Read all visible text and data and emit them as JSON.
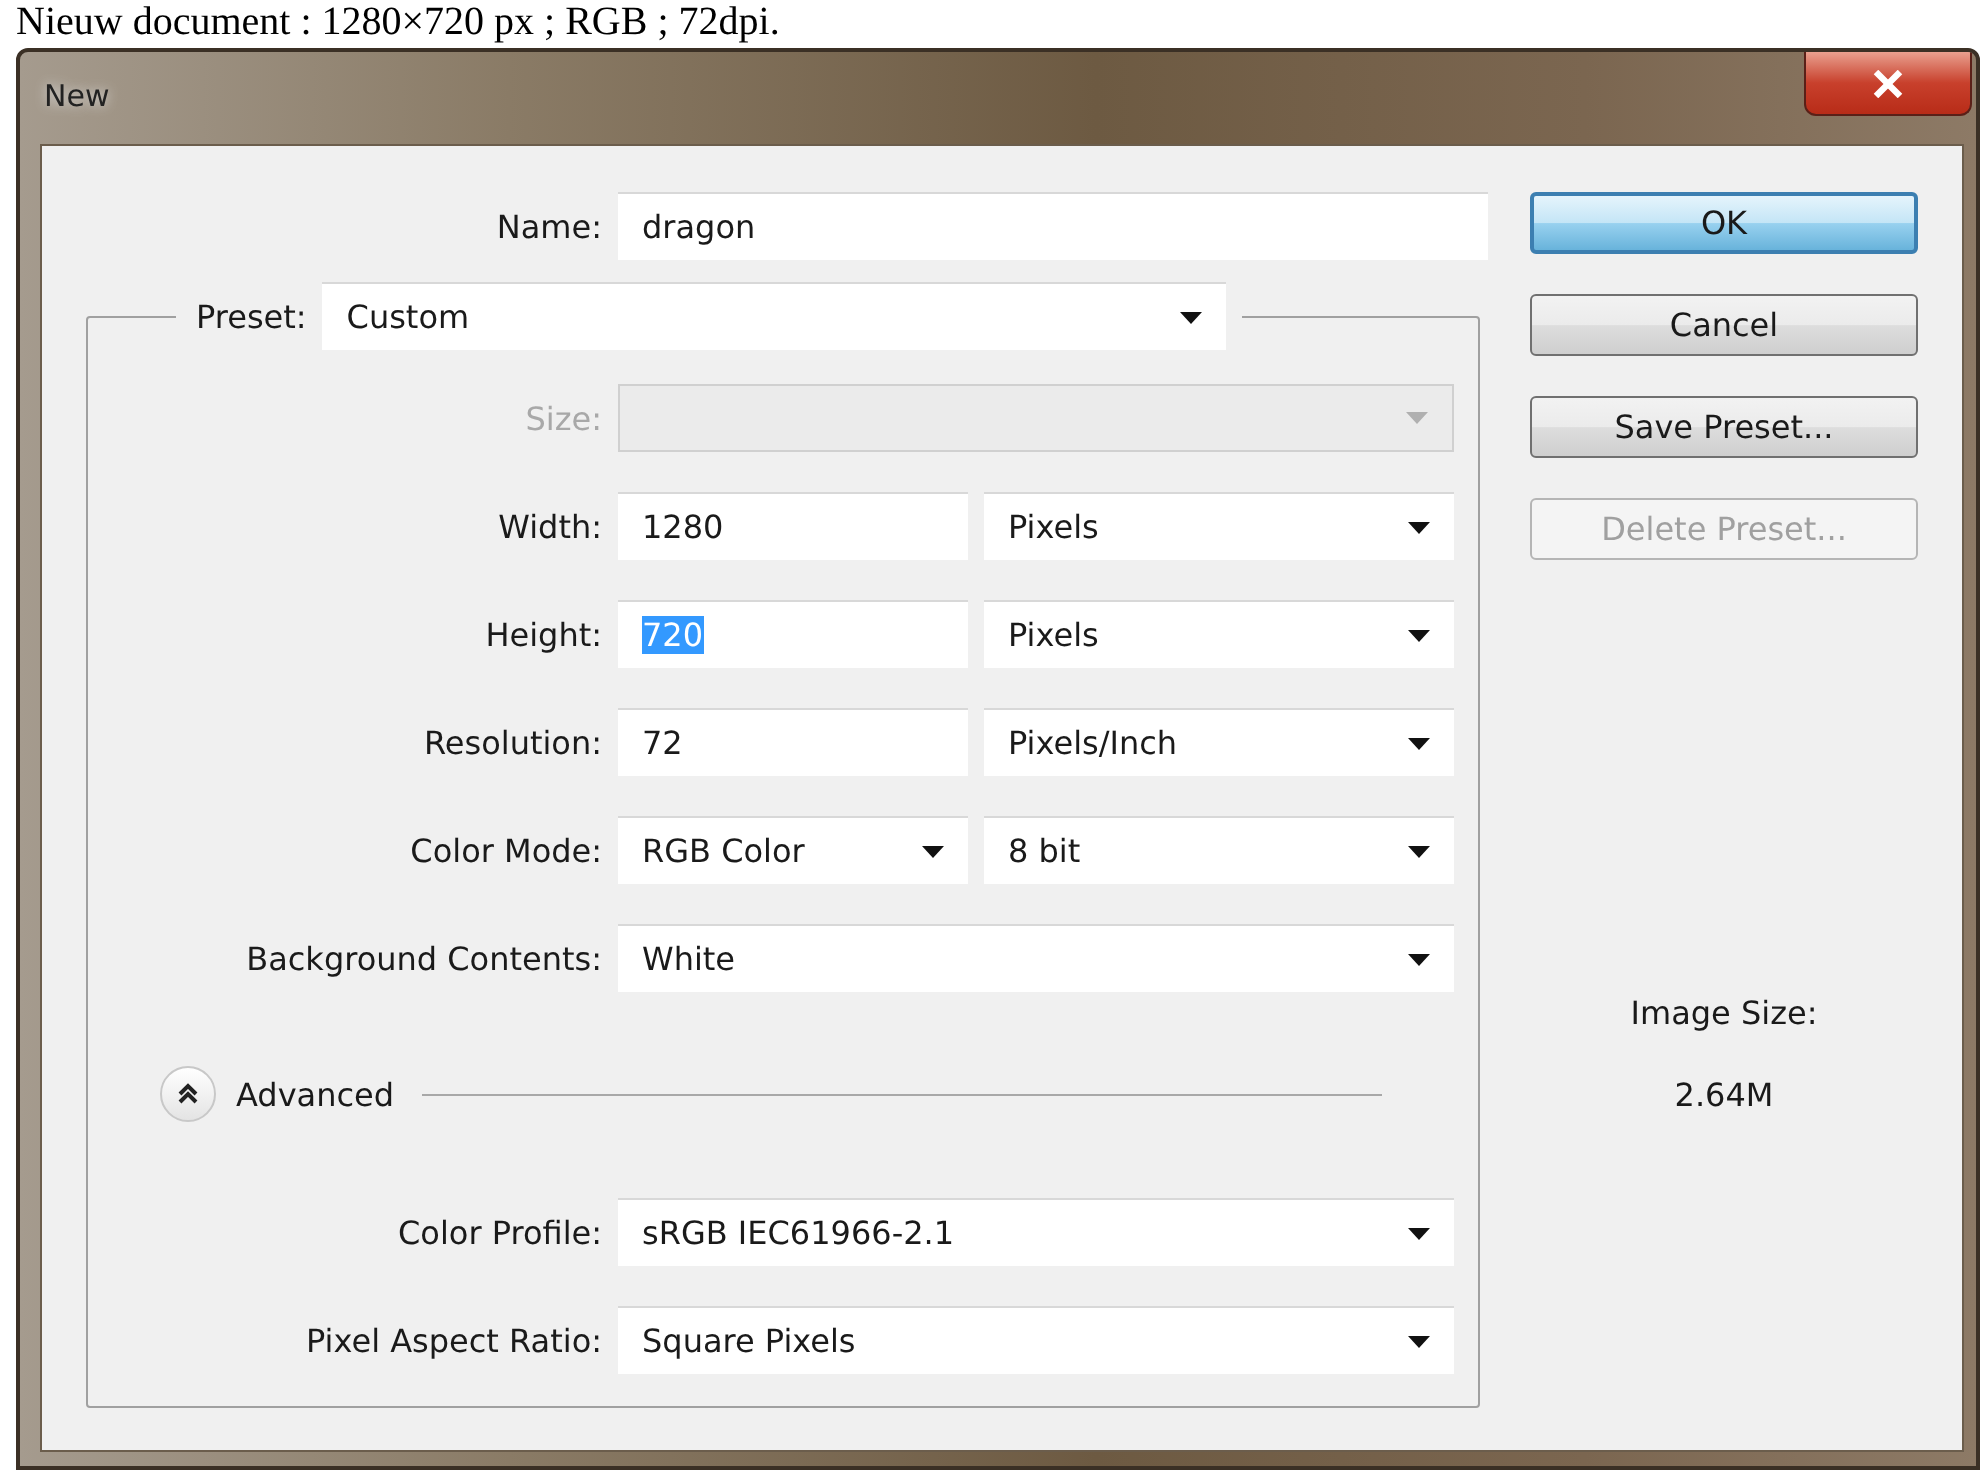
{
  "caption": "Nieuw document : 1280×720 px ; RGB ; 72dpi.",
  "window": {
    "title": "New"
  },
  "name": {
    "label": "Name:",
    "value": "dragon"
  },
  "preset": {
    "label": "Preset:",
    "value": "Custom"
  },
  "rows": [
    {
      "kind": "select",
      "label": "Size:",
      "disabled": true
    },
    {
      "kind": "value-unit",
      "label": "Width:",
      "value": "1280",
      "unit": "Pixels",
      "disabled": false,
      "highlighted": false
    },
    {
      "kind": "value-unit",
      "label": "Height:",
      "value": "720",
      "unit": "Pixels",
      "disabled": false,
      "highlighted": true
    },
    {
      "kind": "value-unit",
      "label": "Resolution:",
      "value": "72",
      "unit": "Pixels/Inch",
      "disabled": false,
      "highlighted": false
    },
    {
      "kind": "select-pair",
      "label": "Color Mode:",
      "value": "RGB Color",
      "unit": "8 bit",
      "disabled": false
    },
    {
      "kind": "select",
      "label": "Background Contents:",
      "value": "White",
      "disabled": false
    }
  ],
  "advanced": {
    "label": "Advanced",
    "expanded": true
  },
  "advanced_rows": [
    {
      "kind": "select",
      "label": "Color Profile:",
      "value": "sRGB IEC61966-2.1",
      "disabled": false
    },
    {
      "kind": "select",
      "label": "Pixel Aspect Ratio:",
      "value": "Square Pixels",
      "disabled": false
    }
  ],
  "buttons": [
    {
      "label": "OK",
      "default": true,
      "disabled": false
    },
    {
      "label": "Cancel",
      "default": false,
      "disabled": false
    },
    {
      "label": "Save Preset...",
      "default": false,
      "disabled": false
    },
    {
      "label": "Delete Preset...",
      "default": false,
      "disabled": true
    }
  ],
  "image_size": {
    "label": "Image Size:",
    "value": "2.64M"
  }
}
